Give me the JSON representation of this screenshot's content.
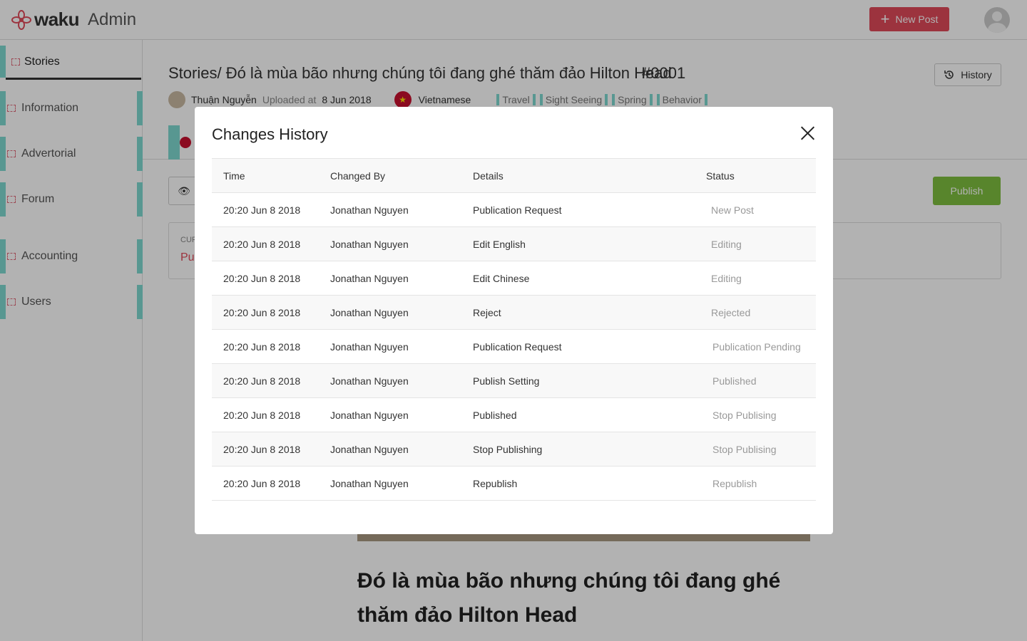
{
  "header": {
    "brand": "waku",
    "brand_suffix": "Admin",
    "new_post_label": "New Post"
  },
  "sidebar": {
    "items": [
      {
        "label": "Stories"
      },
      {
        "label": "Information"
      },
      {
        "label": "Advertorial"
      },
      {
        "label": "Forum"
      },
      {
        "label": "Accounting"
      },
      {
        "label": "Users"
      }
    ]
  },
  "page": {
    "title": "Stories/  Đó là mùa bão nhưng chúng tôi đang ghé thăm đảo Hilton Head",
    "post_id": "#0001",
    "history_label": "History",
    "author": "Thuận Nguyễn",
    "uploaded_label": "Uploaded at",
    "uploaded_date": "8 Jun 2018",
    "language": "Vietnamese",
    "tags": [
      "Travel",
      "Sight Seeing",
      "Spring",
      "Behavior"
    ],
    "publish_label": "Publish",
    "status_label": "CUR",
    "status_value": "Pul",
    "article_title": "Đó là mùa bão nhưng chúng tôi đang ghé thăm đảo Hilton Head"
  },
  "modal": {
    "title": "Changes History",
    "columns": [
      "Time",
      "Changed By",
      "Details",
      "Status"
    ],
    "rows": [
      {
        "time": "20:20 Jun 8 2018",
        "by": "Jonathan Nguyen",
        "details": "Publication Request",
        "status": "New Post"
      },
      {
        "time": "20:20 Jun 8 2018",
        "by": "Jonathan Nguyen",
        "details": "Edit English",
        "status": "Editing"
      },
      {
        "time": "20:20 Jun 8 2018",
        "by": "Jonathan Nguyen",
        "details": "Edit Chinese",
        "status": "Editing"
      },
      {
        "time": "20:20 Jun 8 2018",
        "by": "Jonathan Nguyen",
        "details": "Reject",
        "status": "Rejected"
      },
      {
        "time": "20:20 Jun 8 2018",
        "by": "Jonathan Nguyen",
        "details": "Publication Request",
        "status": "Publication Pending"
      },
      {
        "time": "20:20 Jun 8 2018",
        "by": "Jonathan Nguyen",
        "details": "Publish Setting",
        "status": "Published"
      },
      {
        "time": "20:20 Jun 8 2018",
        "by": "Jonathan Nguyen",
        "details": "Published",
        "status": "Stop Publising"
      },
      {
        "time": "20:20 Jun 8 2018",
        "by": "Jonathan Nguyen",
        "details": "Stop Publishing",
        "status": "Stop Publising"
      },
      {
        "time": "20:20 Jun 8 2018",
        "by": "Jonathan Nguyen",
        "details": "Republish",
        "status": "Republish"
      }
    ]
  },
  "colors": {
    "brand_red": "#e04a5a",
    "publish_green": "#7fbf3f",
    "overlay": "rgba(0,0,0,0.3)"
  }
}
